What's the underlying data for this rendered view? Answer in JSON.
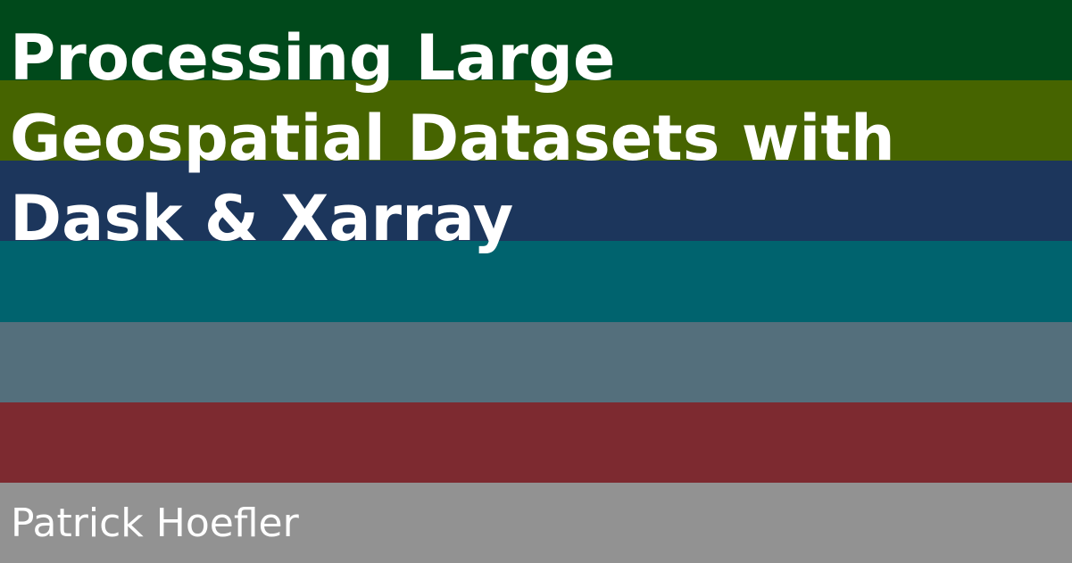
{
  "title_lines": [
    "Processing Large",
    "Geospatial Datasets with",
    "Dask & Xarray"
  ],
  "author": "Patrick Hoefler",
  "stripe_colors": [
    "#00491b",
    "#466400",
    "#1c365c",
    "#00636e",
    "#546f7c",
    "#7d2a30",
    "#929292"
  ]
}
